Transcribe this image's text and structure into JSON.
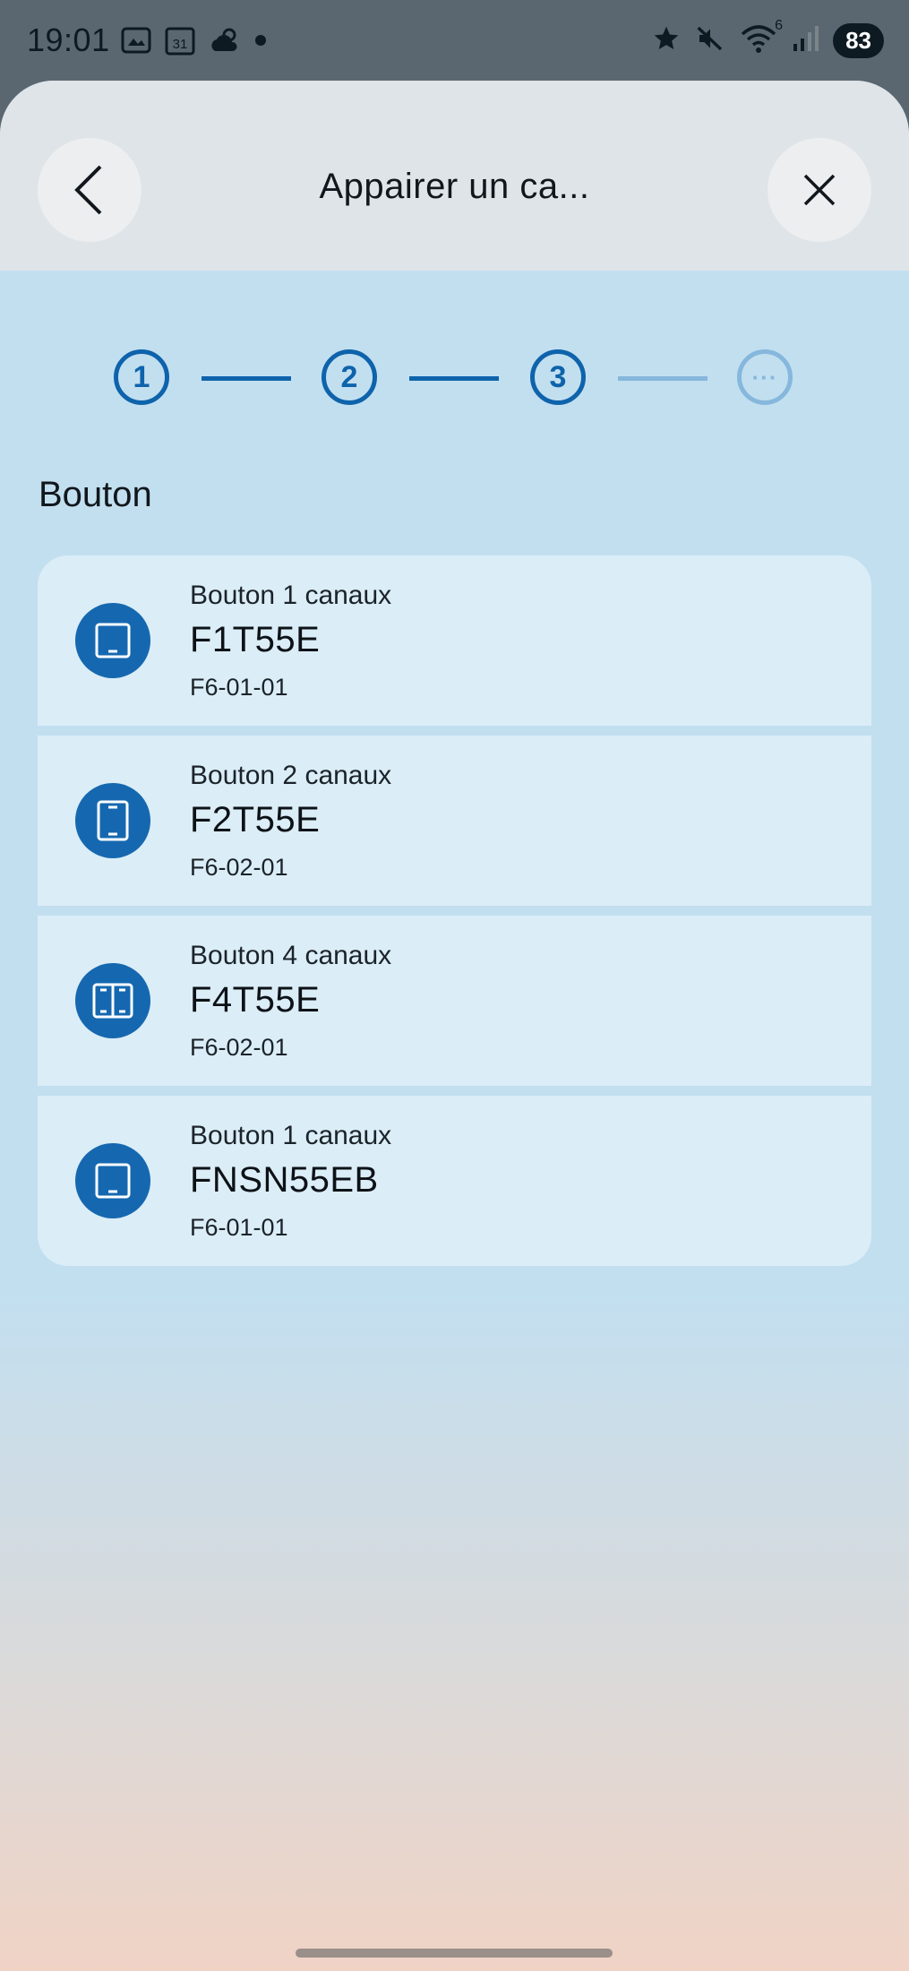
{
  "status_bar": {
    "time": "19:01",
    "calendar_day": "31",
    "battery": "83",
    "wifi_badge": "6"
  },
  "header": {
    "title": "Appairer un ca...",
    "back_icon": "chevron-left-icon",
    "close_icon": "close-icon"
  },
  "stepper": {
    "steps": [
      {
        "label": "1",
        "state": "done"
      },
      {
        "label": "2",
        "state": "done"
      },
      {
        "label": "3",
        "state": "current"
      },
      {
        "label": "···",
        "state": "future"
      }
    ],
    "active_color": "#0e63ab",
    "future_color": "#86b7dc"
  },
  "section": {
    "title": "Bouton"
  },
  "devices": [
    {
      "category": "Bouton 1 canaux",
      "model": "F1T55E",
      "code": "F6-01-01",
      "icon": "single-switch-icon"
    },
    {
      "category": "Bouton 2 canaux",
      "model": "F2T55E",
      "code": "F6-02-01",
      "icon": "double-rocker-switch-icon"
    },
    {
      "category": "Bouton 4 canaux",
      "model": "F4T55E",
      "code": "F6-02-01",
      "icon": "quad-switch-icon"
    },
    {
      "category": "Bouton 1 canaux",
      "model": "FNSN55EB",
      "code": "F6-01-01",
      "icon": "single-switch-icon"
    }
  ],
  "colors": {
    "accent": "#1568b0",
    "card": "#dbedf7",
    "background": "#c2dff0"
  }
}
